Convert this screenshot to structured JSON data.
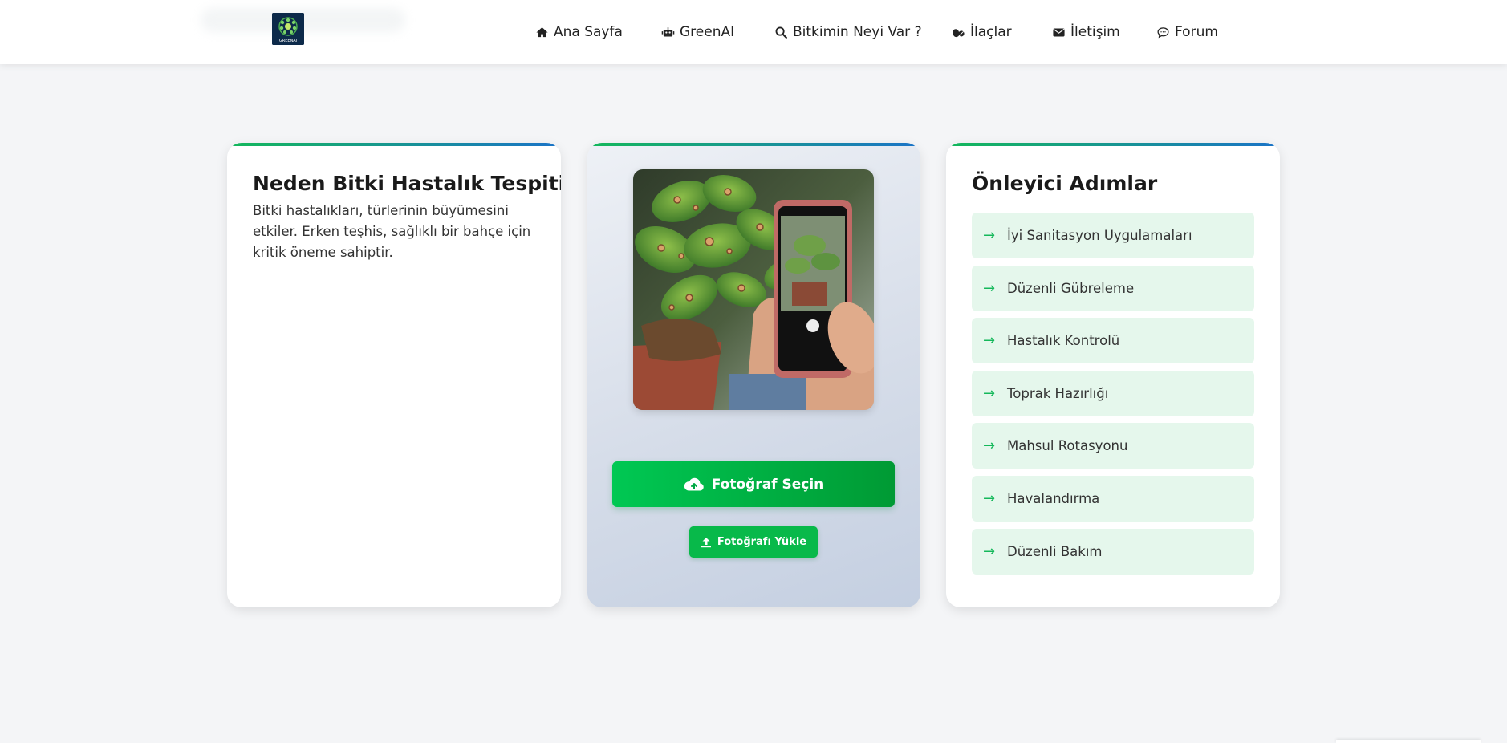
{
  "navbar": {
    "logo_text": "GREENAI",
    "items": [
      {
        "label": "Ana Sayfa",
        "icon": "home-icon"
      },
      {
        "label": "GreenAI",
        "icon": "robot-icon"
      },
      {
        "label": "Bitkimin Neyi Var ?",
        "icon": "search-icon"
      },
      {
        "label": "İlaçlar",
        "icon": "pills-icon"
      },
      {
        "label": "İletişim",
        "icon": "envelope-icon"
      },
      {
        "label": "Forum",
        "icon": "comment-icon"
      }
    ]
  },
  "left_card": {
    "title": "Neden Bitki Hastalık Tespiti?",
    "text": "Bitki hastalıkları, türlerinin büyümesini etkiler. Erken teşhis, sağlıklı bir bahçe için kritik öneme sahiptir."
  },
  "middle_card": {
    "image_icon": "plant-phone-photo",
    "select_label": "Fotoğraf Seçin",
    "upload_label": "Fotoğrafı Yükle"
  },
  "right_card": {
    "title": "Önleyici Adımlar",
    "arrow": "→",
    "steps": [
      "İyi Sanitasyon Uygulamaları",
      "Düzenli Gübreleme",
      "Hastalık Kontrolü",
      "Toprak Hazırlığı",
      "Mahsul Rotasyonu",
      "Havalandırma",
      "Düzenli Bakım"
    ]
  },
  "colors": {
    "accent_green": "#00c853",
    "accent_blue": "#1a73c8",
    "step_bg": "#e5f7ec"
  }
}
